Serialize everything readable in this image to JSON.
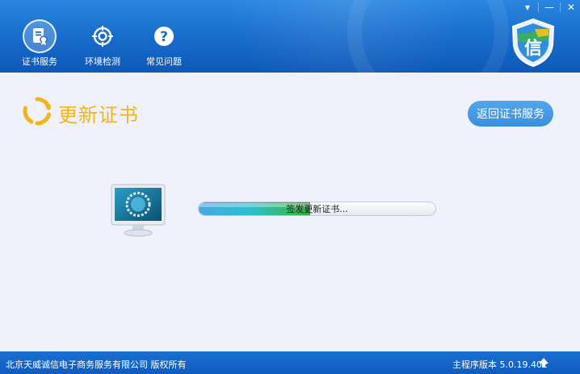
{
  "header": {
    "nav": [
      {
        "label": "证书服务",
        "icon": "certificate-icon",
        "active": true
      },
      {
        "label": "环境检测",
        "icon": "target-icon",
        "active": false
      },
      {
        "label": "常见问题",
        "icon": "question-icon",
        "active": false
      }
    ],
    "window_controls": {
      "dropdown": "▾",
      "minimize": "—",
      "close": "✕"
    },
    "brand_glyph": "信"
  },
  "main": {
    "title": "更新证书",
    "back_button": "返回证书服务",
    "progress": {
      "text": "签发更新证书...",
      "fraction": 0.47
    }
  },
  "footer": {
    "copyright": "北京天威诚信电子商务服务有限公司 版权所有",
    "version_label": "主程序版本",
    "version": "5.0.19.402"
  },
  "colors": {
    "header_blue": "#1a6fce",
    "title_yellow": "#f2b418",
    "button_blue": "#3a8fdc",
    "footer_blue": "#0f5cbf"
  }
}
